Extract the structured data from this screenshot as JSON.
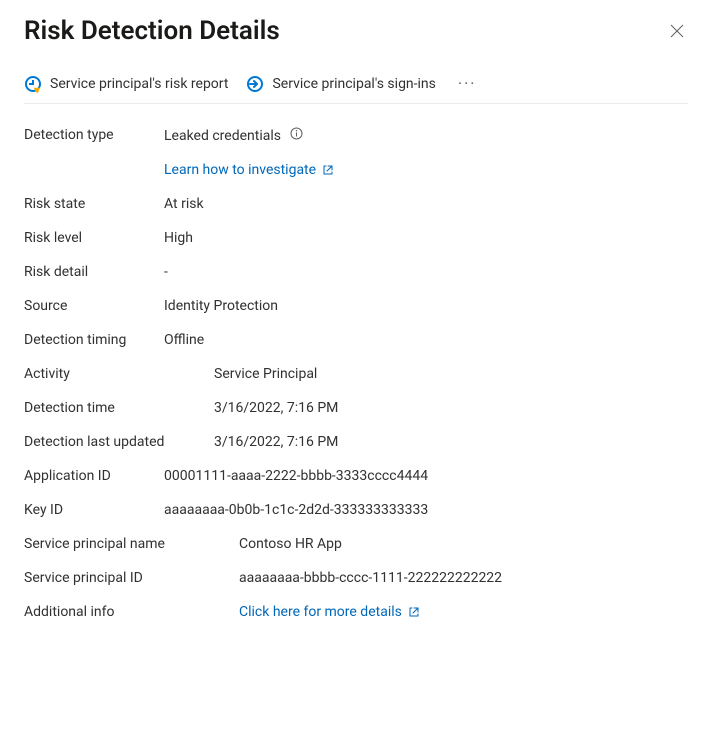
{
  "header": {
    "title": "Risk Detection Details"
  },
  "toolbar": {
    "risk_report": "Service principal's risk report",
    "sign_ins": "Service principal's sign-ins"
  },
  "fields": {
    "detection_type_label": "Detection type",
    "detection_type_value": "Leaked credentials",
    "learn_link": "Learn how to investigate",
    "risk_state_label": "Risk state",
    "risk_state_value": "At risk",
    "risk_level_label": "Risk level",
    "risk_level_value": "High",
    "risk_detail_label": "Risk detail",
    "risk_detail_value": "-",
    "source_label": "Source",
    "source_value": "Identity Protection",
    "detection_timing_label": "Detection timing",
    "detection_timing_value": "Offline",
    "activity_label": "Activity",
    "activity_value": "Service Principal",
    "detection_time_label": "Detection time",
    "detection_time_value": "3/16/2022, 7:16 PM",
    "detection_last_updated_label": "Detection last updated",
    "detection_last_updated_value": "3/16/2022, 7:16 PM",
    "application_id_label": "Application ID",
    "application_id_value": "00001111-aaaa-2222-bbbb-3333cccc4444",
    "key_id_label": "Key ID",
    "key_id_value": "aaaaaaaa-0b0b-1c1c-2d2d-333333333333",
    "sp_name_label": "Service principal name",
    "sp_name_value": "Contoso HR App",
    "sp_id_label": "Service principal ID",
    "sp_id_value": "aaaaaaaa-bbbb-cccc-1111-222222222222",
    "additional_info_label": "Additional info",
    "additional_info_link": "Click here for more details"
  }
}
